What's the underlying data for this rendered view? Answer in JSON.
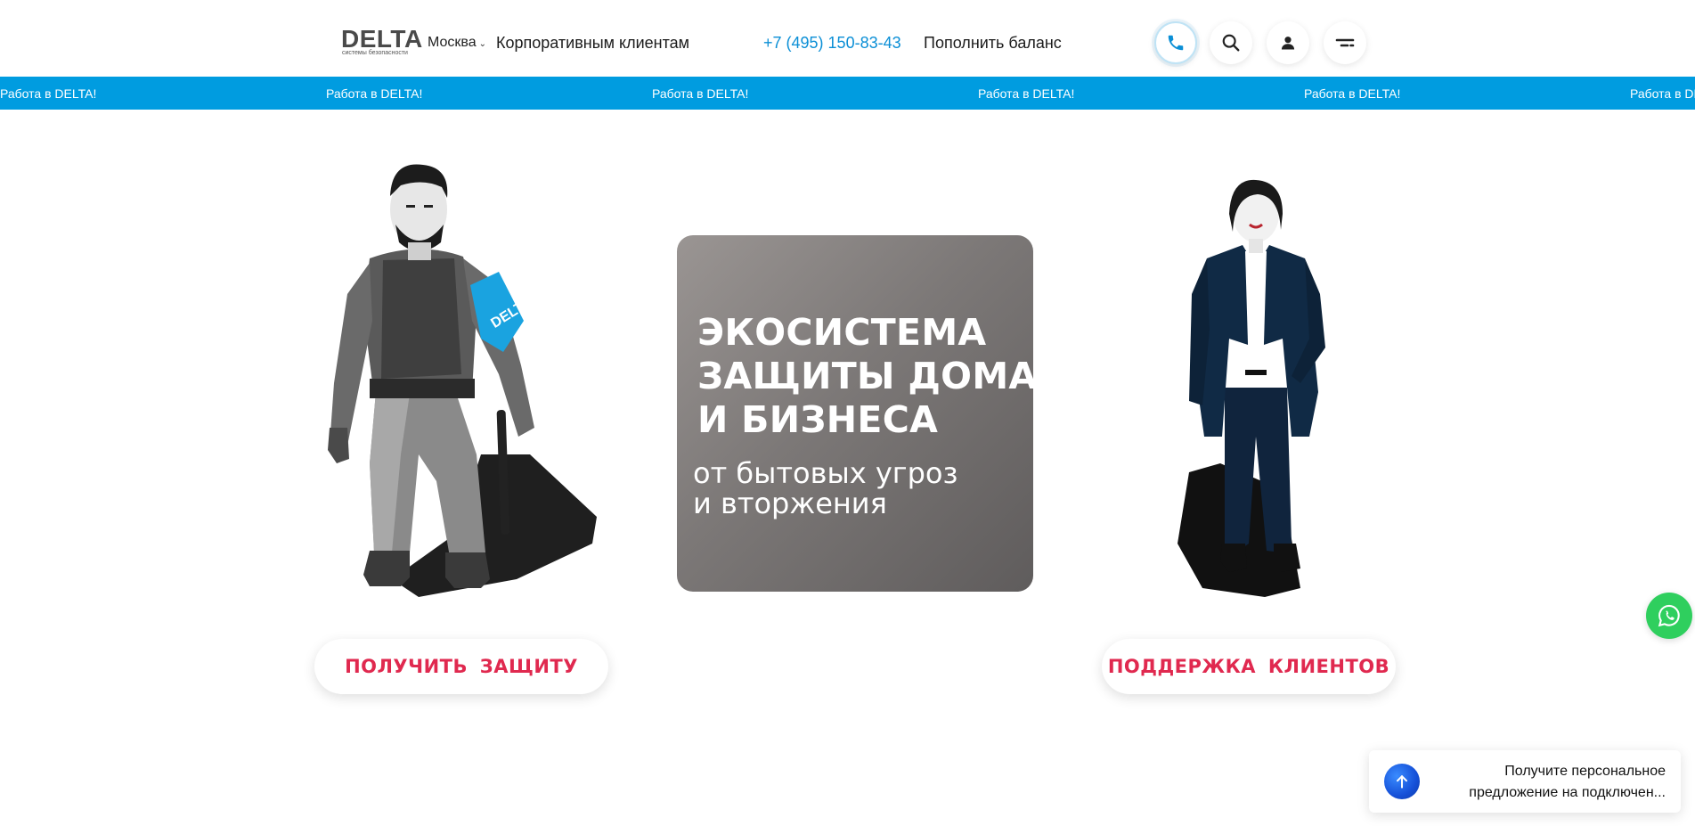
{
  "header": {
    "logo": {
      "main": "DELTA",
      "sub": "системы безопасности"
    },
    "city": "Москва",
    "corporate_link": "Корпоративным клиентам",
    "phone": "+7 (495) 150-83-43",
    "balance_link": "Пополнить баланс",
    "icons": [
      "phone-icon",
      "search-icon",
      "user-icon",
      "menu-icon"
    ]
  },
  "banner": {
    "items": [
      "Работа в DELTA!",
      "Работа в DELTA!",
      "Работа в DELTA!",
      "Работа в DELTA!",
      "Работа в DELTA!",
      "Работа в DELTA!"
    ]
  },
  "hero": {
    "title_lines": [
      "ЭКОСИСТЕМА",
      "ЗАЩИТЫ ДОМА",
      "И БИЗНЕСА"
    ],
    "subtitle_lines": [
      "от бытовых угроз",
      "и вторжения"
    ],
    "armband_text": "DELTA",
    "cta_left": "ПОЛУЧИТЬ  ЗАЩИТУ",
    "cta_right": "ПОДДЕРЖКА  КЛИЕНТОВ"
  },
  "widgets": {
    "whatsapp_icon": "whatsapp-icon",
    "toast_text": "Получите персональное предложение на подключен...",
    "toast_icon": "arrow-up-right-icon"
  },
  "colors": {
    "accent_blue": "#009ce0",
    "cta_red": "#e0294f",
    "whatsapp_green": "#2fcf5e"
  }
}
